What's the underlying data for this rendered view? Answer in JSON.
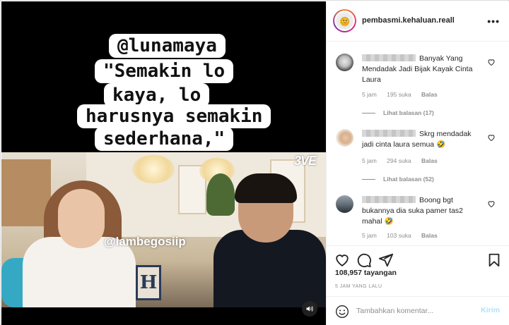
{
  "post": {
    "quote_lines": [
      "@lunamaya",
      "\"Semakin lo",
      "kaya, lo",
      "harusnya semakin",
      "sederhana,\""
    ],
    "watermark": "@lambegosiip",
    "channel_logo": "3VE"
  },
  "header": {
    "username": "pembasmi.kehaluan.reall",
    "more_icon": "more-horizontal-icon"
  },
  "comments": [
    {
      "text": "Banyak Yang Mendadak Jadi Bijak Kayak Cinta Laura",
      "time": "5 jam",
      "likes": "195 suka",
      "reply": "Balas",
      "replies": "Lihat balasan (17)"
    },
    {
      "text": "Skrg mendadak jadi cinta laura semua 🤣",
      "time": "5 jam",
      "likes": "294 suka",
      "reply": "Balas",
      "replies": "Lihat balasan (52)"
    },
    {
      "text": "Boong bgt bukannya dia suka pamer tas2 mahal 🤣",
      "time": "5 jam",
      "likes": "103 suka",
      "reply": "Balas"
    }
  ],
  "actions": {
    "views": "108,957 tayangan",
    "time_ago": "5 JAM YANG LALU"
  },
  "composer": {
    "placeholder": "Tambahkan komentar...",
    "post_label": "Kirim"
  },
  "colors": {
    "accent_disabled": "#b2dffc",
    "muted_text": "#8e8e8e",
    "border": "#efefef"
  }
}
